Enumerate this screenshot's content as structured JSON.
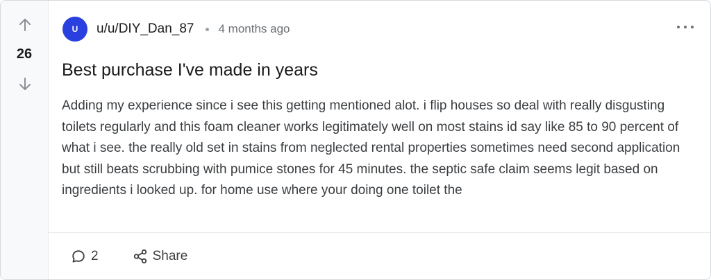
{
  "vote": {
    "count": "26",
    "upvote_icon": "arrow-up-icon",
    "downvote_icon": "arrow-down-icon"
  },
  "author": {
    "avatar_letter": "U",
    "avatar_color": "#2a3fe0",
    "username": "u/u/DIY_Dan_87",
    "timestamp": "4 months ago"
  },
  "menu": {
    "icon": "more-horizontal-icon"
  },
  "post": {
    "title": "Best purchase I've made in years",
    "body": "Adding my experience since i see this getting mentioned alot. i flip houses so deal with really disgusting toilets regularly and this foam cleaner works legitimately well on most stains id say like 85 to 90 percent of what i see. the really old set in stains from neglected rental properties sometimes need second application but still beats scrubbing with pumice stones for 45 minutes. the septic safe claim seems legit based on ingredients i looked up. for home use where your doing one toilet the"
  },
  "actions": {
    "comments_icon": "comment-bubble-icon",
    "comments_count": "2",
    "share_icon": "share-icon",
    "share_label": "Share"
  }
}
